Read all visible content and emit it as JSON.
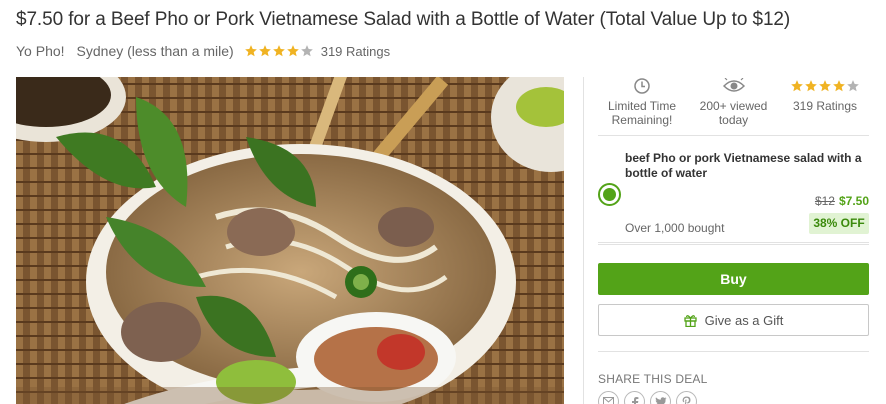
{
  "deal": {
    "title": "$7.50 for a Beef Pho or Pork Vietnamese Salad with a Bottle of Water (Total Value Up to $12)",
    "merchant": "Yo Pho!",
    "location": "Sydney (less than a mile)",
    "rating_stars": 4,
    "rating_max": 5,
    "rating_count": "319 Ratings"
  },
  "photo": {
    "alt": "Bowl of pho with herbs, bean sprouts and beef"
  },
  "stats": {
    "limited_time": "Limited Time Remaining!",
    "viewed": "200+ viewed today",
    "ratings": "319 Ratings",
    "clock_icon": "clock-icon",
    "eye_icon": "eye-icon"
  },
  "option": {
    "name": "beef Pho or pork Vietnamese salad with a bottle of water",
    "old_price": "$12",
    "new_price": "$7.50",
    "discount": "38% OFF",
    "bought": "Over 1,000 bought",
    "selected": true
  },
  "actions": {
    "buy_label": "Buy",
    "gift_label": "Give as a Gift",
    "gift_icon": "gift-icon"
  },
  "share": {
    "label": "SHARE THIS DEAL",
    "icons": [
      "email-icon",
      "facebook-icon",
      "twitter-icon",
      "pinterest-icon"
    ]
  },
  "colors": {
    "accent": "#53a318",
    "star": "#f0b323",
    "star_empty": "#b3b3b3",
    "discount_bg": "#e1f3d3"
  }
}
